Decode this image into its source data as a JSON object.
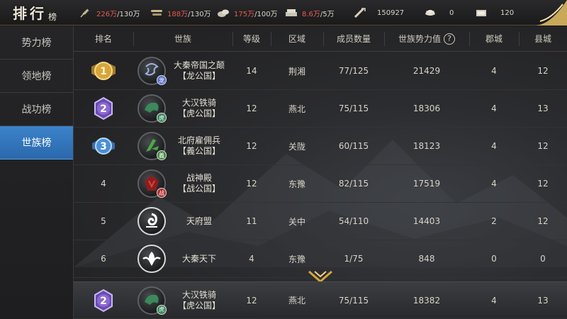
{
  "title": {
    "main": "排行",
    "sub": "榜"
  },
  "resources": [
    {
      "icon": "grain-icon",
      "value": "226万",
      "cap": "/130万"
    },
    {
      "icon": "wood-icon",
      "value": "188万",
      "cap": "/130万"
    },
    {
      "icon": "stone-icon",
      "value": "175万",
      "cap": "/100万"
    },
    {
      "icon": "iron-icon",
      "value": "8.6万",
      "cap": "/5万"
    },
    {
      "icon": "command-icon",
      "value": "150927"
    },
    {
      "icon": "gold-icon",
      "value": "0"
    },
    {
      "icon": "silver-icon",
      "value": "120"
    }
  ],
  "sidebar": {
    "items": [
      {
        "label": "势力榜"
      },
      {
        "label": "领地榜"
      },
      {
        "label": "战功榜"
      },
      {
        "label": "世族榜"
      }
    ],
    "active": "世族榜"
  },
  "table": {
    "headers": {
      "rank": "排名",
      "clan": "世族",
      "level": "等级",
      "area": "区域",
      "members": "成员数量",
      "power": "世族势力值",
      "help": "?",
      "jun": "郡城",
      "xian": "县城"
    },
    "rows": [
      {
        "rank": "1",
        "name1": "大秦帝国之颠",
        "name2": "【龙公国】",
        "tag": "龙",
        "tagColor": "#5b74c9",
        "level": "14",
        "area": "荆湘",
        "members": "77/125",
        "power": "21429",
        "jun": "4",
        "xian": "12"
      },
      {
        "rank": "2",
        "name1": "大汉铁骑",
        "name2": "【虎公国】",
        "tag": "虎",
        "tagColor": "#3a8a5a",
        "level": "12",
        "area": "燕北",
        "members": "75/115",
        "power": "18306",
        "jun": "4",
        "xian": "13"
      },
      {
        "rank": "3",
        "name1": "北府雇佣兵",
        "name2": "【義公国】",
        "tag": "義",
        "tagColor": "#3f8a3a",
        "level": "12",
        "area": "关陇",
        "members": "60/115",
        "power": "18123",
        "jun": "4",
        "xian": "12"
      },
      {
        "rank": "4",
        "name1": "战神殿",
        "name2": "【战公国】",
        "tag": "战",
        "tagColor": "#b02a2a",
        "level": "12",
        "area": "东豫",
        "members": "82/115",
        "power": "17519",
        "jun": "4",
        "xian": "12"
      },
      {
        "rank": "5",
        "name1": "天府盟",
        "name2": "",
        "tag": "",
        "tagColor": "",
        "level": "11",
        "area": "关中",
        "members": "54/110",
        "power": "14403",
        "jun": "2",
        "xian": "12"
      },
      {
        "rank": "6",
        "name1": "大秦天下",
        "name2": "",
        "tag": "",
        "tagColor": "",
        "level": "4",
        "area": "东豫",
        "members": "1/75",
        "power": "848",
        "jun": "0",
        "xian": "0"
      }
    ],
    "mine": {
      "rank": "2",
      "name1": "大汉铁骑",
      "name2": "【虎公国】",
      "tag": "虎",
      "tagColor": "#3a8a5a",
      "level": "12",
      "area": "燕北",
      "members": "75/115",
      "power": "18382",
      "jun": "4",
      "xian": "13"
    }
  },
  "colors": {
    "accent": "#2f74bd",
    "resourceOver": "#e65a4a",
    "gold": "#d7a53a",
    "purple": "#8a6ad0",
    "blue": "#4a8fd6"
  }
}
